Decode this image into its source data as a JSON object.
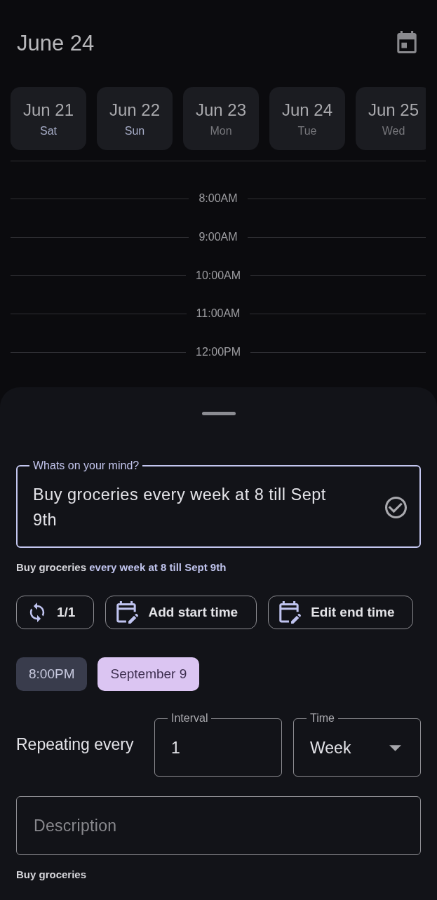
{
  "header": {
    "title": "June 24"
  },
  "days": [
    {
      "date": "Jun 21",
      "weekday": "Sat",
      "weekend": true
    },
    {
      "date": "Jun 22",
      "weekday": "Sun",
      "weekend": true
    },
    {
      "date": "Jun 23",
      "weekday": "Mon",
      "weekend": false
    },
    {
      "date": "Jun 24",
      "weekday": "Tue",
      "weekend": false
    },
    {
      "date": "Jun 25",
      "weekday": "Wed",
      "weekend": false
    }
  ],
  "timeline": {
    "hours": [
      "8:00AM",
      "9:00AM",
      "10:00AM",
      "11:00AM",
      "12:00PM"
    ]
  },
  "sheet": {
    "task_field": {
      "label": "Whats on your mind?",
      "value": "Buy groceries every week at 8 till Sept 9th",
      "focused": true
    },
    "parsed_hint": [
      {
        "text": "Buy groceries",
        "kind": "title"
      },
      {
        "text": "every week at 8 till Sept 9th",
        "kind": "match"
      }
    ],
    "actions": [
      {
        "kind": "repeat",
        "label": "1/1"
      },
      {
        "kind": "calendar-edit",
        "label": "Add start time"
      },
      {
        "kind": "calendar-edit",
        "label": "Edit end time"
      }
    ],
    "tags": [
      {
        "kind": "time",
        "label": "8:00PM"
      },
      {
        "kind": "date",
        "label": "September 9"
      }
    ],
    "repeat": {
      "label": "Repeating every",
      "interval": {
        "label": "Interval",
        "value": "1"
      },
      "unit": {
        "label": "Time",
        "value": "Week"
      }
    },
    "description": {
      "placeholder": "Description"
    },
    "footer_text": "Buy groceries"
  }
}
